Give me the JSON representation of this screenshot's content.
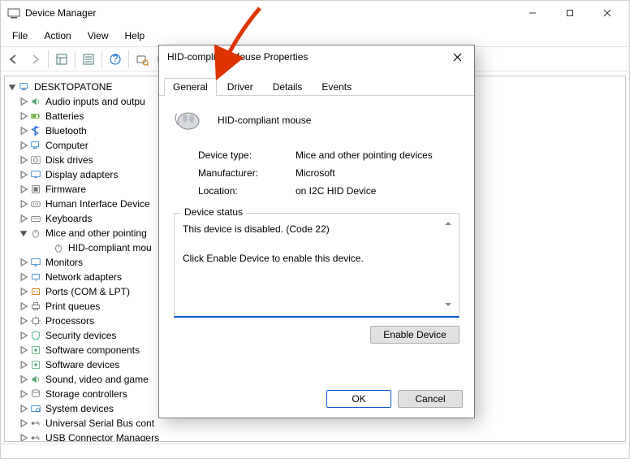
{
  "window": {
    "title": "Device Manager",
    "menus": [
      "File",
      "Action",
      "View",
      "Help"
    ]
  },
  "tree": {
    "root": {
      "label": "DESKTOPATONE"
    },
    "nodes": [
      {
        "label": "Audio inputs and outpu",
        "icon": "audio"
      },
      {
        "label": "Batteries",
        "icon": "battery"
      },
      {
        "label": "Bluetooth",
        "icon": "bluetooth"
      },
      {
        "label": "Computer",
        "icon": "computer"
      },
      {
        "label": "Disk drives",
        "icon": "disk"
      },
      {
        "label": "Display adapters",
        "icon": "display"
      },
      {
        "label": "Firmware",
        "icon": "firmware"
      },
      {
        "label": "Human Interface Device",
        "icon": "hid"
      },
      {
        "label": "Keyboards",
        "icon": "keyboard"
      },
      {
        "label": "Mice and other pointing",
        "icon": "mouse",
        "expanded": true,
        "children": [
          {
            "label": "HID-compliant mou",
            "icon": "mouse"
          }
        ]
      },
      {
        "label": "Monitors",
        "icon": "monitor"
      },
      {
        "label": "Network adapters",
        "icon": "network"
      },
      {
        "label": "Ports (COM & LPT)",
        "icon": "ports"
      },
      {
        "label": "Print queues",
        "icon": "printer"
      },
      {
        "label": "Processors",
        "icon": "cpu"
      },
      {
        "label": "Security devices",
        "icon": "security"
      },
      {
        "label": "Software components",
        "icon": "sw"
      },
      {
        "label": "Software devices",
        "icon": "sw"
      },
      {
        "label": "Sound, video and game",
        "icon": "audio"
      },
      {
        "label": "Storage controllers",
        "icon": "storage"
      },
      {
        "label": "System devices",
        "icon": "system"
      },
      {
        "label": "Universal Serial Bus cont",
        "icon": "usb"
      },
      {
        "label": "USB Connector Managers",
        "icon": "usb"
      }
    ]
  },
  "dialog": {
    "title": "HID-compliant Mouse Properties",
    "tabs": [
      "General",
      "Driver",
      "Details",
      "Events"
    ],
    "activeTab": "General",
    "headline": "HID-compliant mouse",
    "info": {
      "k0": "Device type:",
      "v0": "Mice and other pointing devices",
      "k1": "Manufacturer:",
      "v1": "Microsoft",
      "k2": "Location:",
      "v2": "on I2C HID Device"
    },
    "status": {
      "legend": "Device status",
      "line1": "This device is disabled. (Code 22)",
      "line2": "Click Enable Device to enable this device."
    },
    "enableButton": "Enable Device",
    "ok": "OK",
    "cancel": "Cancel"
  }
}
